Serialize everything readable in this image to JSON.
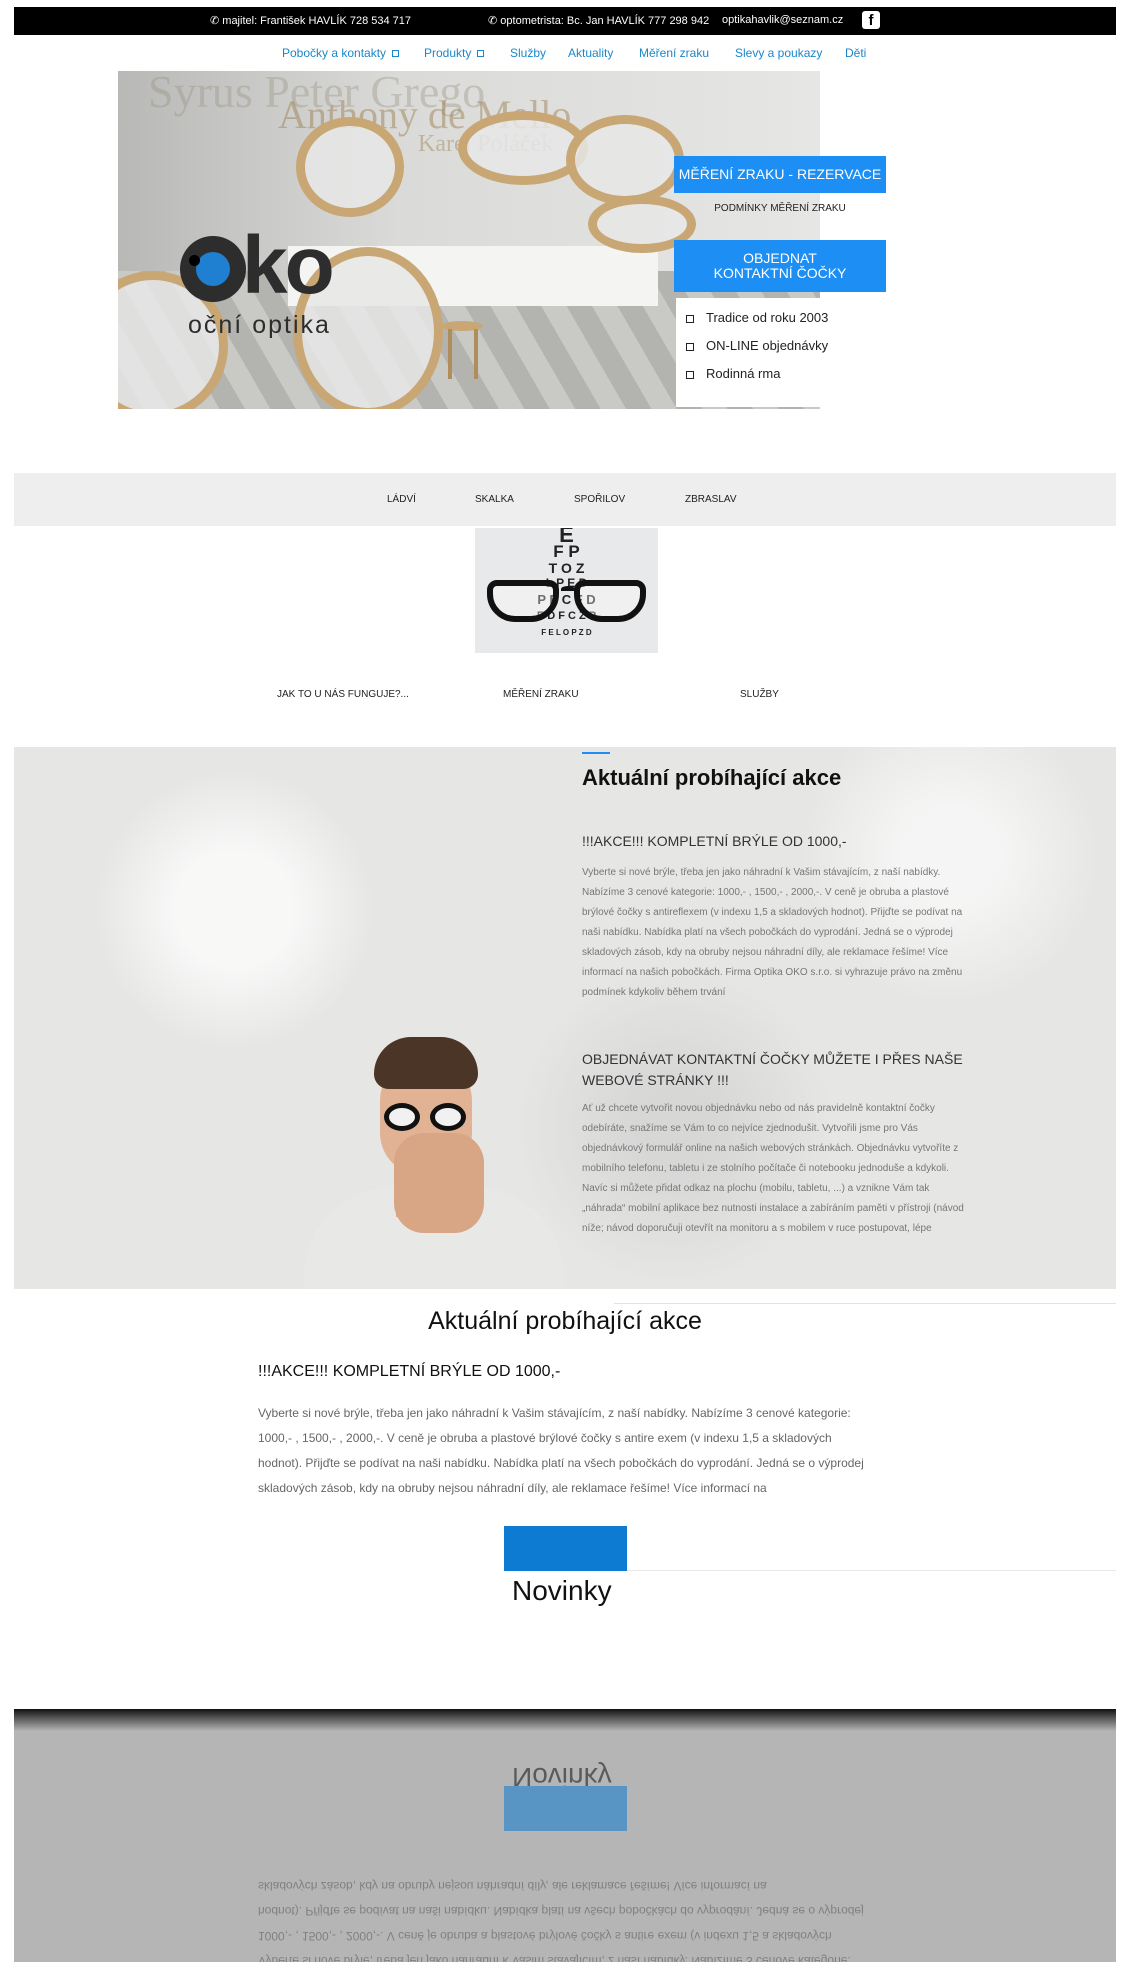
{
  "topbar": {
    "owner": "majitel: František HAVLÍK 728 534 717",
    "optometrist": "optometrista: Bc. Jan HAVLÍK 777 298 942",
    "email": "optikahavlik@seznam.cz",
    "facebook_glyph": "f"
  },
  "nav": {
    "items": [
      "Pobočky a kontakty",
      "Produkty",
      "Služby",
      "Aktuality",
      "Měření zraku",
      "Slevy a poukazy",
      "Děti"
    ]
  },
  "hero": {
    "wall_text": "Syrus Peter Grego",
    "wall_text2": "Anthony de Mello",
    "wall_text3": "Karel Poláček",
    "logo_text": "ko",
    "logo_sub": "oční optika",
    "cta_booking": "MĚŘENÍ ZRAKU - REZERVACE",
    "cta_conditions": "PODMÍNKY MĚŘENÍ ZRAKU",
    "cta_order_line1": "OBJEDNAT",
    "cta_order_line2": "KONTAKTNÍ ČOČKY",
    "benefits": [
      "Tradice od roku 2003",
      "ON-LINE objednávky",
      "Rodinná  rma"
    ]
  },
  "branches": [
    "LÁDVÍ",
    "SKALKA",
    "SPOŘILOV",
    "ZBRASLAV"
  ],
  "eye_chart": {
    "rows": [
      "E",
      "F P",
      "T O Z",
      "L P E D",
      "P E C F D",
      "E D F C Z P",
      "F E L O P Z D"
    ]
  },
  "subnav": [
    "JAK TO U NÁS FUNGUJE?...",
    "MĚŘENÍ ZRAKU",
    "SLUŽBY"
  ],
  "promo": {
    "title": "Aktuální probíhající akce",
    "item1_title": "!!!AKCE!!! KOMPLETNÍ BRÝLE OD 1000,-",
    "item1_text": "Vyberte si nové brýle, třeba jen jako náhradní k Vašim stávajícím, z naší nabídky. Nabízíme 3 cenové kategorie: 1000,- , 1500,- , 2000,-. V ceně je obruba a plastové brýlové čočky s antireflexem (v indexu 1,5 a skladových hodnot). Přijďte se podívat na naši nabídku. Nabídka platí na všech pobočkách do vyprodání. Jedná se o výprodej skladových zásob, kdy na obruby nejsou náhradní díly, ale reklamace řešíme! Více informací na našich pobočkách. Firma Optika OKO s.r.o. si vyhrazuje právo na změnu podmínek kdykoliv během trvání",
    "item2_title": "OBJEDNÁVAT KONTAKTNÍ ČOČKY MŮŽETE I PŘES NAŠE WEBOVÉ STRÁNKY !!!",
    "item2_text": "Ať už chcete vytvořit novou objednávku nebo od nás pravidelně kontaktní čočky odebíráte, snažíme se Vám to co nejvíce zjednodušit. Vytvořili jsme pro Vás objednávkový formulář online na našich webových stránkách. Objednávku vytvoříte z mobilního telefonu, tabletu i ze stolního počítače či notebooku jednoduše a kdykoli. Navíc si můžete přidat odkaz na plochu (mobilu, tabletu, ...) a vznikne Vám tak „náhrada“ mobilní aplikace bez nutnosti instalace a zabíráním paměti v přístroji (návod níže; návod doporučuji otevřít na monitoru a s mobilem v ruce postupovat, lépe"
  },
  "section2": {
    "title": "Aktuální probíhající akce",
    "item_title": "!!!AKCE!!! KOMPLETNÍ BRÝLE OD 1000,-",
    "item_text": "Vyberte si nové brýle, třeba jen jako náhradní k Vašim stávajícím, z naší nabídky. Nabízíme 3 cenové kategorie: 1000,- , 1500,- , 2000,-. V ceně je obruba a plastové brýlové čočky s antire exem (v indexu 1,5 a skladových hodnot). Přijďte se podívat na naši nabídku. Nabídka platí na všech pobočkách do vyprodání. Jedná se o výprodej skladových zásob, kdy na obruby nejsou náhradní díly, ale reklamace řešíme! Více informací na",
    "news_title": "Novinky"
  },
  "colors": {
    "accent": "#1c8ef4",
    "link": "#1b87c9",
    "topbar_bg": "#000000",
    "block_blue": "#0e7bd2"
  },
  "icons": {
    "phone": "phone-icon",
    "facebook": "facebook-icon",
    "caret": "chevron-down-icon",
    "checkbox": "checkbox-icon"
  }
}
